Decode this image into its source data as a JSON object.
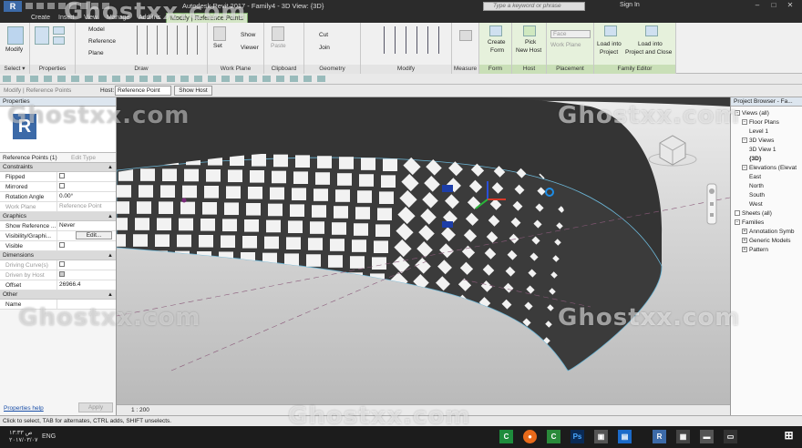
{
  "titlebar": {
    "doc_title": "Autodesk Revit 2017 -     Family4 - 3D View: {3D}",
    "search_placeholder": "Type a keyword or phrase",
    "signin": "Sign In",
    "app_icon": "R"
  },
  "tabs": [
    "Create",
    "Insert",
    "View",
    "Manage",
    "Add-Ins",
    "Modify | Reference Points"
  ],
  "ribbon": {
    "select": {
      "modify": "Modify",
      "label": "Select ▾"
    },
    "properties": {
      "label": "Properties"
    },
    "draw": {
      "model": "Model",
      "reference": "Reference",
      "plane": "Plane",
      "label": "Draw"
    },
    "work_plane": {
      "set": "Set",
      "show": "Show",
      "viewer": "Viewer",
      "label": "Work Plane"
    },
    "clipboard": {
      "paste": "Paste",
      "label": "Clipboard"
    },
    "geometry": {
      "cut": "Cut",
      "join": "Join",
      "label": "Geometry"
    },
    "modify": {
      "label": "Modify"
    },
    "measure": {
      "label": "Measure"
    },
    "form": {
      "create": "Create",
      "form": "Form",
      "label": "Form"
    },
    "host": {
      "pick": "Pick",
      "newhost": "New Host",
      "label": "Host"
    },
    "placement": {
      "face": "Face",
      "workplane": "Work Plane",
      "label": "Placement"
    },
    "family_editor": {
      "load_project": "Load into",
      "load_project2": "Project",
      "load_close": "Load into",
      "load_close2": "Project and Close",
      "label": "Family Editor"
    }
  },
  "optionsbar": {
    "crumb": "Modify | Reference Points",
    "host_label": "Host:",
    "host_value": "Reference Point",
    "show_host": "Show Host"
  },
  "properties": {
    "header": "Properties",
    "preview_icon": "R",
    "type_selector": "Reference Points (1)",
    "edit_type": "Edit Type",
    "groups": [
      {
        "name": "Constraints",
        "rows": [
          {
            "k": "Flipped",
            "v": "",
            "check": false
          },
          {
            "k": "Mirrored",
            "v": "",
            "check": false
          },
          {
            "k": "Rotation Angle",
            "v": "0.00°"
          },
          {
            "k": "Work Plane",
            "v": "Reference Point",
            "grey": true
          }
        ]
      },
      {
        "name": "Graphics",
        "rows": [
          {
            "k": "Show Reference ...",
            "v": "Never"
          },
          {
            "k": "Visibility/Graphi...",
            "v": "Edit...",
            "button": true
          },
          {
            "k": "Visible",
            "v": "",
            "check": false
          }
        ]
      },
      {
        "name": "Dimensions",
        "rows": [
          {
            "k": "Driving Curve(s)",
            "v": "",
            "check": false,
            "grey": true
          },
          {
            "k": "Driven by Host",
            "v": "",
            "check": true,
            "grey": true
          },
          {
            "k": "Offset",
            "v": "26966.4"
          }
        ]
      },
      {
        "name": "Other",
        "rows": [
          {
            "k": "Name",
            "v": ""
          }
        ]
      }
    ],
    "help": "Properties help",
    "apply": "Apply"
  },
  "viewport": {
    "scale": "1 : 200"
  },
  "project_browser": {
    "header": "Project Browser - Fa...",
    "nodes": [
      {
        "label": "Views (all)",
        "level": 0,
        "exp": "−"
      },
      {
        "label": "Floor Plans",
        "level": 1,
        "exp": "−"
      },
      {
        "label": "Level 1",
        "level": 2
      },
      {
        "label": "3D Views",
        "level": 1,
        "exp": "−"
      },
      {
        "label": "3D View 1",
        "level": 2
      },
      {
        "label": "{3D}",
        "level": 2,
        "bold": true
      },
      {
        "label": "Elevations (Elevat",
        "level": 1,
        "exp": "−"
      },
      {
        "label": "East",
        "level": 2
      },
      {
        "label": "North",
        "level": 2
      },
      {
        "label": "South",
        "level": 2
      },
      {
        "label": "West",
        "level": 2
      },
      {
        "label": "Sheets (all)",
        "level": 0,
        "exp": ""
      },
      {
        "label": "Families",
        "level": 0,
        "exp": "−"
      },
      {
        "label": "Annotation Symb",
        "level": 1,
        "exp": "+"
      },
      {
        "label": "Generic Models",
        "level": 1,
        "exp": "+"
      },
      {
        "label": "Pattern",
        "level": 1,
        "exp": "+"
      }
    ]
  },
  "statusbar": "Click to select, TAB for alternates, CTRL adds, SHIFT unselects.",
  "taskbar": {
    "time": "۱۳:۳۳ ص",
    "date": "۲۰۱۷/۰۳/۰۷",
    "lang": "ENG"
  },
  "watermark": "Ghostxx.com"
}
